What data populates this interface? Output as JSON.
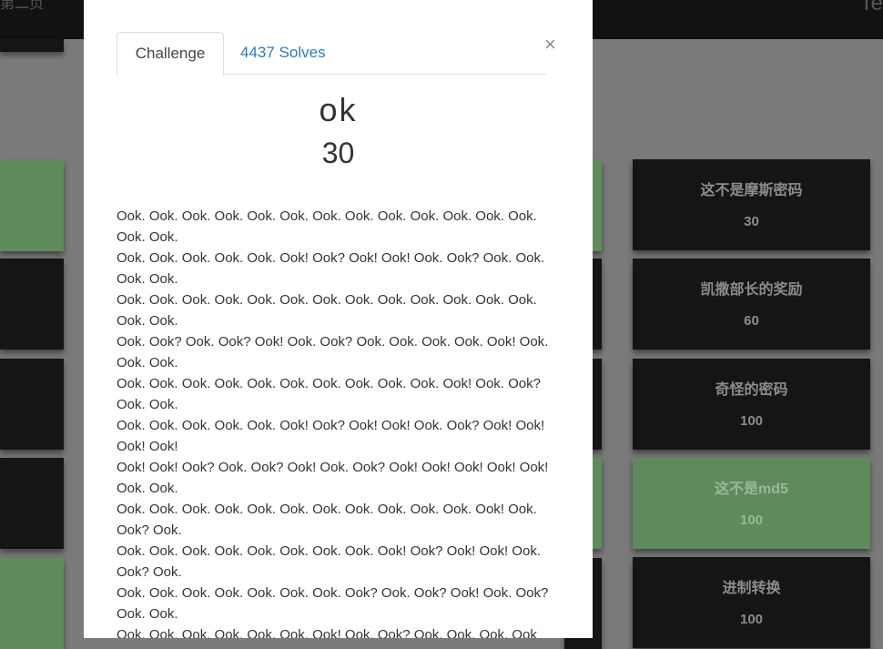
{
  "topbar": {
    "left_text": "第二页",
    "right_text": "Te"
  },
  "board_cards": [
    {
      "name": "这不是摩斯密码",
      "value": "30",
      "solved": false
    },
    {
      "name": "凯撒部长的奖励",
      "value": "60",
      "solved": false
    },
    {
      "name": "奇怪的密码",
      "value": "100",
      "solved": false
    },
    {
      "name": "这不是md5",
      "value": "100",
      "solved": true
    },
    {
      "name": "进制转换",
      "value": "100",
      "solved": false
    }
  ],
  "modal": {
    "tab_challenge": "Challenge",
    "tab_solves": "4437 Solves",
    "close_symbol": "×",
    "name": "ok",
    "value": "30",
    "description_lines": [
      "Ook. Ook. Ook. Ook. Ook. Ook. Ook. Ook. Ook. Ook. Ook. Ook. Ook. Ook. Ook.",
      "Ook. Ook. Ook. Ook. Ook. Ook! Ook? Ook! Ook! Ook. Ook? Ook. Ook. Ook. Ook.",
      "Ook. Ook. Ook. Ook. Ook. Ook. Ook. Ook. Ook. Ook. Ook. Ook. Ook. Ook. Ook.",
      "Ook. Ook? Ook. Ook? Ook! Ook. Ook? Ook. Ook. Ook. Ook. Ook! Ook. Ook. Ook.",
      "Ook. Ook. Ook. Ook. Ook. Ook. Ook. Ook. Ook. Ook. Ook! Ook. Ook? Ook. Ook.",
      "Ook. Ook. Ook. Ook. Ook. Ook! Ook? Ook! Ook! Ook. Ook? Ook! Ook! Ook! Ook!",
      "Ook! Ook! Ook? Ook. Ook? Ook! Ook. Ook? Ook! Ook! Ook! Ook! Ook! Ook. Ook.",
      "Ook. Ook. Ook. Ook. Ook. Ook. Ook. Ook. Ook. Ook. Ook. Ook! Ook. Ook? Ook.",
      "Ook. Ook. Ook. Ook. Ook. Ook. Ook. Ook. Ook! Ook? Ook! Ook! Ook. Ook? Ook.",
      "Ook. Ook. Ook. Ook. Ook. Ook. Ook. Ook? Ook. Ook? Ook! Ook. Ook? Ook. Ook.",
      "Ook. Ook. Ook. Ook. Ook. Ook. Ook! Ook. Ook? Ook. Ook. Ook. Ook"
    ]
  },
  "colors": {
    "overlay": "#7a7a7a",
    "card_dark": "#131517",
    "card_solved": "#5f8a5c",
    "link": "#337ab7"
  }
}
